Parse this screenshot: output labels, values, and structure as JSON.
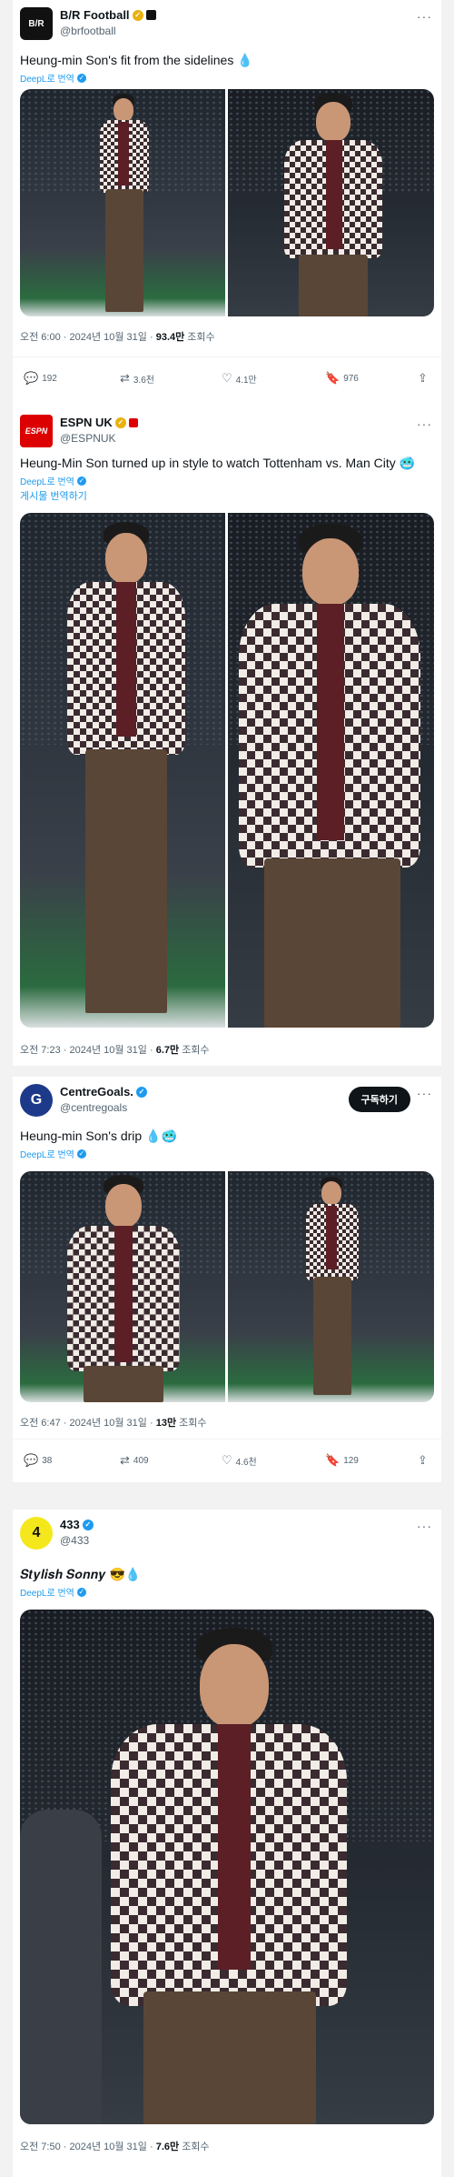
{
  "posts": [
    {
      "name": "B/R Football",
      "handle": "@brfootball",
      "text": "Heung-min Son's fit from the sidelines 💧",
      "translate": "DeepL로 번역",
      "time": "오전 6:00",
      "date": "2024년 10월 31일",
      "views": "93.4만",
      "views_label": "조회수",
      "actions": {
        "reply": "192",
        "repost": "3.6천",
        "like": "4.1만",
        "bookmark": "976"
      }
    },
    {
      "name": "ESPN UK",
      "handle": "@ESPNUK",
      "text": "Heung-Min Son turned up in style to watch Tottenham vs. Man City 🥶",
      "translate": "DeepL로 번역",
      "translate_post": "게시물 번역하기",
      "time": "오전 7:23",
      "date": "2024년 10월 31일",
      "views": "6.7만",
      "views_label": "조회수"
    },
    {
      "name": "CentreGoals.",
      "handle": "@centregoals",
      "follow": "구독하기",
      "text": "Heung-min Son's drip 💧🥶",
      "translate": "DeepL로 번역",
      "time": "오전 6:47",
      "date": "2024년 10월 31일",
      "views": "13만",
      "views_label": "조회수",
      "actions": {
        "reply": "38",
        "repost": "409",
        "like": "4.6천",
        "bookmark": "129"
      }
    },
    {
      "name": "433",
      "handle": "@433",
      "text": "𝑺𝒕𝒚𝒍𝒊𝒔𝒉 𝑺𝒐𝒏𝒏𝒚 😎💧",
      "translate": "DeepL로 번역",
      "time": "오전 7:50",
      "date": "2024년 10월 31일",
      "views": "7.6만",
      "views_label": "조회수"
    }
  ],
  "icons": {
    "reply": "speech-bubble-icon",
    "repost": "repost-arrows-icon",
    "like": "heart-icon",
    "bookmark": "bookmark-icon",
    "share": "share-icon",
    "more": "more-dots-icon",
    "verified": "verified-badge-icon"
  },
  "colors": {
    "accent": "#1d9bf0",
    "gold_badge": "#e8b10d",
    "text": "#0f1419",
    "muted": "#536471"
  },
  "avatars": {
    "br": "B/R",
    "espn": "ESPN",
    "cg": "G",
    "433": "4"
  }
}
